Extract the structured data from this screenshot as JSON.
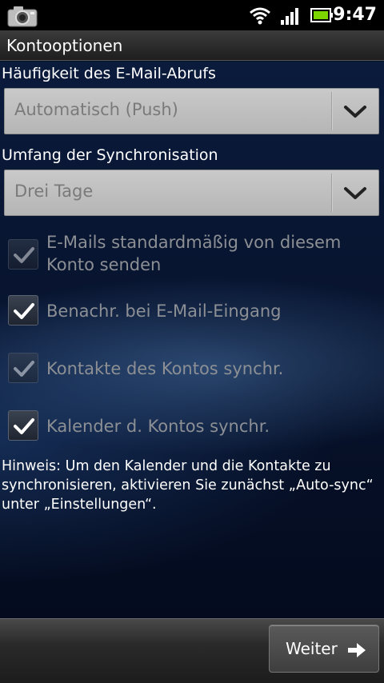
{
  "statusbar": {
    "time": "9:47",
    "icons": [
      "camera-icon",
      "wifi-icon",
      "signal-icon",
      "battery-icon"
    ]
  },
  "titlebar": {
    "title": "Kontooptionen"
  },
  "form": {
    "fetch_frequency": {
      "label": "Häufigkeit des E-Mail-Abrufs",
      "value": "Automatisch (Push)"
    },
    "sync_range": {
      "label": "Umfang der Synchronisation",
      "value": "Drei Tage"
    },
    "checkboxes": [
      {
        "line1": "E-Mails standardmäßig von diesem",
        "line2": "Konto senden",
        "checked": true,
        "enabled": false
      },
      {
        "line1": "Benachr. bei E-Mail-Eingang",
        "checked": true,
        "enabled": true
      },
      {
        "line1": "Kontakte des Kontos synchr.",
        "checked": true,
        "enabled": false
      },
      {
        "line1": "Kalender d. Kontos synchr.",
        "checked": true,
        "enabled": true
      }
    ],
    "hint": "Hinweis: Um den Kalender und die Kontakte zu synchronisieren, aktivieren Sie zunächst „Auto-sync“ unter „Einstellungen“."
  },
  "bottombar": {
    "next_label": "Weiter"
  },
  "colors": {
    "spinner_bg": "#c0c0c0",
    "spinner_text": "#7a7a7a",
    "disabled_text": "#8c8f94",
    "background": "#06112a"
  }
}
